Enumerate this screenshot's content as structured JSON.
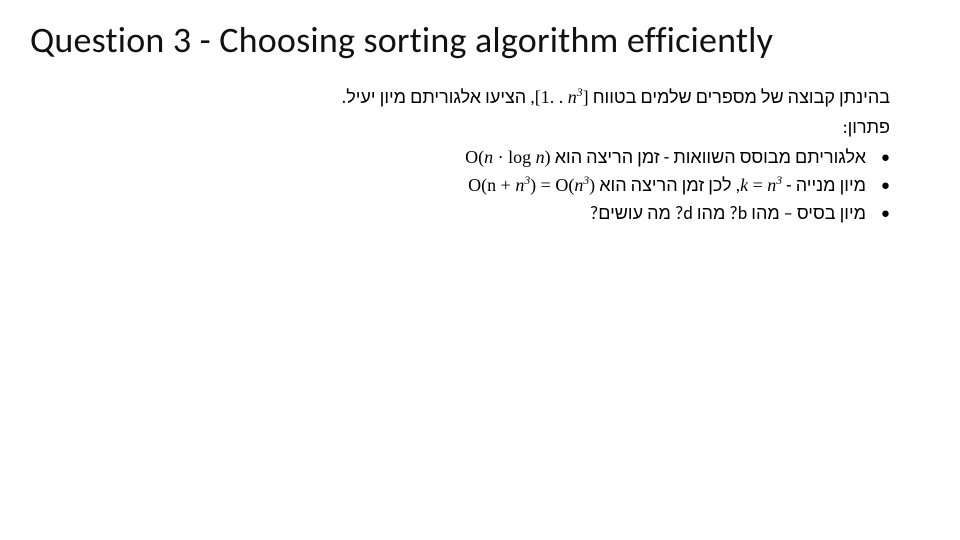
{
  "title": "Question 3 - Choosing sorting algorithm efficiently",
  "line1_pre": "בהינתן קבוצה של מספרים שלמים בטווח ",
  "line1_math_open": "[1. . ",
  "line1_math_var": "n",
  "line1_math_sup": "3",
  "line1_math_close": "]",
  "line1_post": ", הציעו אלגוריתם מיון יעיל.",
  "solution_label": "פתרון:",
  "bullet1_pre": "אלגוריתם מבוסס השוואות - זמן הריצה הוא ",
  "bullet1_math": "O(n · log n)",
  "bullet2_pre": "מיון מנייה - ",
  "bullet2_k": "k",
  "bullet2_eq": " = ",
  "bullet2_n": "n",
  "bullet2_sup": "3",
  "bullet2_mid": ", לכן זמן הריצה הוא ",
  "bullet2_mathA_open": "O(n + ",
  "bullet2_mathA_var": "n",
  "bullet2_mathA_sup": "3",
  "bullet2_mathA_close": ") = O(",
  "bullet2_mathB_var": "n",
  "bullet2_mathB_sup": "3",
  "bullet2_mathB_close": ")",
  "bullet3": "מיון בסיס – מהו b? מהו d? מה עושים?"
}
